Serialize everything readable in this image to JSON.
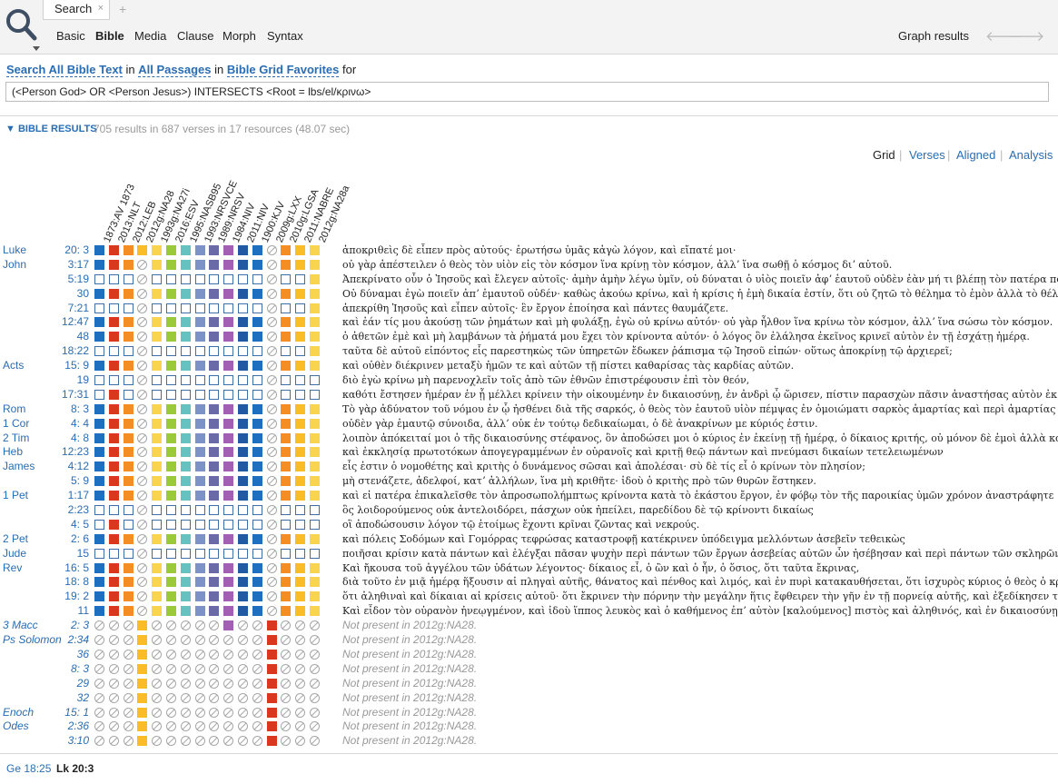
{
  "toolbar": {
    "tab_label": "Search",
    "tab_close": "×",
    "tab_add": "+",
    "modes": [
      "Basic",
      "Bible",
      "Media",
      "Clause",
      "Morph",
      "Syntax"
    ],
    "active_mode": "Bible",
    "graph_results": "Graph results",
    "back_arrow": "🡐",
    "forward_arrow": "🡒"
  },
  "query": {
    "link_search_all": "Search All Bible Text",
    "word_in": "in",
    "link_passages": "All Passages",
    "word_in2": "in",
    "link_favorites": "Bible Grid Favorites",
    "word_for": "for",
    "text": "(<Person God> OR <Person Jesus>) INTERSECTS <Root = lbs/el/κρινω>"
  },
  "results": {
    "toggle": "▼",
    "title": "BIBLE RESULTS",
    "stats": "705 results in 687 verses in 17 resources (48.07 sec)"
  },
  "views": [
    "Grid",
    "Verses",
    "Aligned",
    "Analysis"
  ],
  "active_view": "Grid",
  "view_separator": "|",
  "resources": [
    "1873:AV 1873",
    "2013:NLT",
    "2012:LEB",
    "2012g:NA28",
    "1993g:NA27i",
    "2016:ESV",
    "1995:NASB95",
    "1993:NRSVCE",
    "1989:NRSV",
    "1984:NIV",
    "2011:NIV",
    "1900:KJV",
    "2009g:LXX",
    "2010g:LGSA",
    "2011:NABRE",
    "2012g:NA28a"
  ],
  "resource_colors": [
    "#1f6fc1",
    "#d9381e",
    "#f58d25",
    "#fbbd27",
    "#f9d44e",
    "#9ac93a",
    "#66c2c0",
    "#7d93c8",
    "#6a6aa8",
    "#a25fb3",
    "#2159a3",
    "#1f6fc1",
    "#d9381e",
    "#f58d25",
    "#fbbd27",
    "#f9d44e"
  ],
  "rows": [
    {
      "book": "Luke",
      "ref": "20:  3",
      "cells": "ffffffffffff-fff",
      "text": "ἀποκριθεὶς δὲ εἶπεν πρὸς αὐτούς· ἐρωτήσω ὑμᾶς κἀγὼ λόγον, καὶ εἴπατέ μοι·"
    },
    {
      "book": "John",
      "ref": "3:17",
      "cells": "fff-ffffffff-fff",
      "text": "οὐ γὰρ ἀπέστειλεν ὁ θεὸς τὸν υἱὸν εἰς τὸν κόσμον ἵνα κρίνῃ τὸν κόσμον, ἀλλʼ ἵνα σωθῇ ὁ κόσμος διʼ αὐτοῦ."
    },
    {
      "book": "",
      "ref": "5:19",
      "cells": "eee-eeeeeeee-eef",
      "text": "Ἀπεκρίνατο οὖν ὁ Ἰησοῦς καὶ ἔλεγεν αὐτοῖς· ἀμὴν ἀμὴν λέγω ὑμῖν, οὐ δύναται ὁ υἱὸς ποιεῖν ἀφʼ ἑαυτοῦ οὐδὲν ἐὰν μή τι βλέπῃ τὸν πατέρα ποιοῦντα·"
    },
    {
      "book": "",
      "ref": "30",
      "cells": "fff-ffffffff-fff",
      "text": "Οὐ δύναμαι ἐγὼ ποιεῖν ἀπʼ ἐμαυτοῦ οὐδέν· καθὼς ἀκούω κρίνω, καὶ ἡ κρίσις ἡ ἐμὴ δικαία ἐστίν, ὅτι οὐ ζητῶ τὸ θέλημα τὸ ἐμὸν ἀλλὰ τὸ θέλημα τοῦ πέμψαντός με."
    },
    {
      "book": "",
      "ref": "7:21",
      "cells": "eee-eeeeeeee-eef",
      "text": "ἀπεκρίθη Ἰησοῦς καὶ εἶπεν αὐτοῖς· ἓν ἔργον ἐποίησα καὶ πάντες θαυμάζετε."
    },
    {
      "book": "",
      "ref": "12:47",
      "cells": "fff-ffffffff-fff",
      "text": "καὶ ἐάν τίς μου ἀκούσῃ τῶν ῥημάτων καὶ μὴ φυλάξῃ, ἐγὼ οὐ κρίνω αὐτόν· οὐ γὰρ ἦλθον ἵνα κρίνω τὸν κόσμον, ἀλλʼ ἵνα σώσω τὸν κόσμον."
    },
    {
      "book": "",
      "ref": "48",
      "cells": "fff-ffffffff-fff",
      "text": "ὁ ἀθετῶν ἐμὲ καὶ μὴ λαμβάνων τὰ ῥήματά μου ἔχει τὸν κρίνοντα αὐτόν· ὁ λόγος ὃν ἐλάλησα ἐκεῖνος κρινεῖ αὐτὸν ἐν τῇ ἐσχάτῃ ἡμέρᾳ."
    },
    {
      "book": "",
      "ref": "18:22",
      "cells": "eee-eeeeeeee-eef",
      "text": "ταῦτα δὲ αὐτοῦ εἰπόντος εἷς παρεστηκὼς τῶν ὑπηρετῶν ἔδωκεν ῥάπισμα τῷ Ἰησοῦ εἰπών· οὕτως ἀποκρίνῃ τῷ ἀρχιερεῖ;"
    },
    {
      "book": "Acts",
      "ref": "15:  9",
      "cells": "fff-ffffffff-fff",
      "text": "καὶ οὐθὲν διέκρινεν μεταξὺ ἡμῶν τε καὶ αὐτῶν τῇ πίστει καθαρίσας τὰς καρδίας αὐτῶν."
    },
    {
      "book": "",
      "ref": "19",
      "cells": "eee-eeeeeeee-eee",
      "text": "διὸ ἐγὼ κρίνω μὴ παρενοχλεῖν τοῖς ἀπὸ τῶν ἐθνῶν ἐπιστρέφουσιν ἐπὶ τὸν θεόν,"
    },
    {
      "book": "",
      "ref": "17:31",
      "cells": "efe-eeeeeeee-eee",
      "text": "καθότι ἔστησεν ἡμέραν ἐν ᾗ μέλλει κρίνειν τὴν οἰκουμένην ἐν δικαιοσύνῃ, ἐν ἀνδρὶ ᾧ ὥρισεν, πίστιν παρασχὼν πᾶσιν ἀναστήσας αὐτὸν ἐκ νεκρῶν."
    },
    {
      "book": "Rom",
      "ref": "8:  3",
      "cells": "fff-ffffffff-fff",
      "text": "Τὸ γὰρ ἀδύνατον τοῦ νόμου ἐν ᾧ ἠσθένει διὰ τῆς σαρκός, ὁ θεὸς τὸν ἑαυτοῦ υἱὸν πέμψας ἐν ὁμοιώματι σαρκὸς ἁμαρτίας καὶ περὶ ἁμαρτίας κατέκρινεν τὴν ἁμαρτίαν ἐν τῇ σαρκί,"
    },
    {
      "book": "1 Cor",
      "ref": "4:  4",
      "cells": "fff-ffffffff-fff",
      "text": "οὐδὲν γὰρ ἐμαυτῷ σύνοιδα, ἀλλʼ οὐκ ἐν τούτῳ δεδικαίωμαι, ὁ δὲ ἀνακρίνων με κύριός ἐστιν."
    },
    {
      "book": "2 Tim",
      "ref": "4:  8",
      "cells": "fff-ffffffff-fff",
      "text": "λοιπὸν ἀπόκειταί μοι ὁ τῆς δικαιοσύνης στέφανος, ὃν ἀποδώσει μοι ὁ κύριος ἐν ἐκείνῃ τῇ ἡμέρᾳ, ὁ δίκαιος κριτής, οὐ μόνον δὲ ἐμοὶ ἀλλὰ καὶ πᾶσι τοῖς ἠγαπηκόσι τὴν ἐπιφάνειαν αὐτοῦ."
    },
    {
      "book": "Heb",
      "ref": "12:23",
      "cells": "fff-ffffffff-fff",
      "text": "καὶ ἐκκλησίᾳ πρωτοτόκων ἀπογεγραμμένων ἐν οὐρανοῖς καὶ κριτῇ θεῷ πάντων καὶ πνεύμασι δικαίων τετελειωμένων"
    },
    {
      "book": "James",
      "ref": "4:12",
      "cells": "fff-ffffffff-fff",
      "text": "εἷς ἐστιν ὁ νομοθέτης καὶ κριτὴς ὁ δυνάμενος σῶσαι καὶ ἀπολέσαι· σὺ δὲ τίς εἶ ὁ κρίνων τὸν πλησίον;"
    },
    {
      "book": "",
      "ref": "5:  9",
      "cells": "fff-ffffffff-fff",
      "text": "μὴ στενάζετε, ἀδελφοί, κατʼ ἀλλήλων, ἵνα μὴ κριθῆτε· ἰδοὺ ὁ κριτὴς πρὸ τῶν θυρῶν ἕστηκεν."
    },
    {
      "book": "1 Pet",
      "ref": "1:17",
      "cells": "fff-ffffffff-fff",
      "text": "καὶ εἰ πατέρα ἐπικαλεῖσθε τὸν ἀπροσωπολήμπτως κρίνοντα κατὰ τὸ ἑκάστου ἔργον, ἐν φόβῳ τὸν τῆς παροικίας ὑμῶν χρόνον ἀναστράφητε"
    },
    {
      "book": "",
      "ref": "2:23",
      "cells": "eee-eeeeeeee-eee",
      "text": "ὃς λοιδορούμενος οὐκ ἀντελοιδόρει, πάσχων οὐκ ἠπείλει, παρεδίδου δὲ τῷ κρίνοντι δικαίως"
    },
    {
      "book": "",
      "ref": "4:  5",
      "cells": "efe-eeeeeeee-eee",
      "text": "οἳ ἀποδώσουσιν λόγον τῷ ἑτοίμως ἔχοντι κρῖναι ζῶντας καὶ νεκρούς."
    },
    {
      "book": "2 Pet",
      "ref": "2:  6",
      "cells": "fff-ffffffff-fff",
      "text": "καὶ πόλεις Σοδόμων καὶ Γομόρρας τεφρώσας καταστροφῇ κατέκρινεν ὑπόδειγμα μελλόντων ἀσεβεῖν τεθεικὼς"
    },
    {
      "book": "Jude",
      "ref": "15",
      "cells": "eee-eeeeeeee-eee",
      "text": "ποιῆσαι κρίσιν κατὰ πάντων καὶ ἐλέγξαι πᾶσαν ψυχὴν περὶ πάντων τῶν ἔργων ἀσεβείας αὐτῶν ὧν ἠσέβησαν καὶ περὶ πάντων τῶν σκληρῶν ὧν ἐλάλησαν κατʼ αὐτοῦ ἁμαρτωλοὶ ἀσεβεῖς."
    },
    {
      "book": "Rev",
      "ref": "16:  5",
      "cells": "fff-ffffffff-fff",
      "text": "Καὶ ἤκουσα τοῦ ἀγγέλου τῶν ὑδάτων λέγοντος· δίκαιος εἶ, ὁ ὢν καὶ ὁ ἦν, ὁ ὅσιος, ὅτι ταῦτα ἔκρινας,"
    },
    {
      "book": "",
      "ref": "18:  8",
      "cells": "fff-ffffffff-fff",
      "text": "διὰ τοῦτο ἐν μιᾷ ἡμέρᾳ ἥξουσιν αἱ πληγαὶ αὐτῆς, θάνατος καὶ πένθος καὶ λιμός, καὶ ἐν πυρὶ κατακαυθήσεται, ὅτι ἰσχυρὸς κύριος ὁ θεὸς ὁ κρίνας αὐτήν."
    },
    {
      "book": "",
      "ref": "19:  2",
      "cells": "fff-ffffffff-fff",
      "text": "ὅτι ἀληθιναὶ καὶ δίκαιαι αἱ κρίσεις αὐτοῦ· ὅτι ἔκρινεν τὴν πόρνην τὴν μεγάλην ἥτις ἔφθειρεν τὴν γῆν ἐν τῇ πορνείᾳ αὐτῆς, καὶ ἐξεδίκησεν τὸ αἷμα τῶν δούλων αὐτοῦ ἐκ χειρὸς αὐτῆς."
    },
    {
      "book": "",
      "ref": "11",
      "cells": "fff-ffffffff-fff",
      "text": "Καὶ εἶδον τὸν οὐρανὸν ἠνεῳγμένον, καὶ ἰδοὺ ἵππος λευκὸς καὶ ὁ καθήμενος ἐπʼ αὐτὸν [καλούμενος] πιστὸς καὶ ἀληθινός, καὶ ἐν δικαιοσύνῃ κρίνει καὶ πολεμεῖ."
    },
    {
      "book": "3 Macc",
      "ref": "2:  3",
      "cells": "---f-----f--f---",
      "text": "Not present in 2012g:NA28.",
      "missing": true
    },
    {
      "book": "Ps Solomon",
      "ref": "2:34",
      "cells": "---f--------f---",
      "text": "Not present in 2012g:NA28.",
      "missing": true
    },
    {
      "book": "",
      "ref": "36",
      "cells": "---f--------f---",
      "text": "Not present in 2012g:NA28.",
      "missing": true
    },
    {
      "book": "",
      "ref": "8:  3",
      "cells": "---f--------f---",
      "text": "Not present in 2012g:NA28.",
      "missing": true
    },
    {
      "book": "",
      "ref": "29",
      "cells": "---f--------f---",
      "text": "Not present in 2012g:NA28.",
      "missing": true
    },
    {
      "book": "",
      "ref": "32",
      "cells": "---f--------f---",
      "text": "Not present in 2012g:NA28.",
      "missing": true
    },
    {
      "book": "Enoch",
      "ref": "15:  1",
      "cells": "---f--------f---",
      "text": "Not present in 2012g:NA28.",
      "missing": true
    },
    {
      "book": "Odes",
      "ref": "2:36",
      "cells": "---f--------f---",
      "text": "Not present in 2012g:NA28.",
      "missing": true
    },
    {
      "book": "",
      "ref": "3:10",
      "cells": "---f--------f---",
      "text": "Not present in 2012g:NA28.",
      "missing": true
    }
  ],
  "status": {
    "prev_ref": "Ge 18:25",
    "current_ref": "Lk 20:3"
  }
}
